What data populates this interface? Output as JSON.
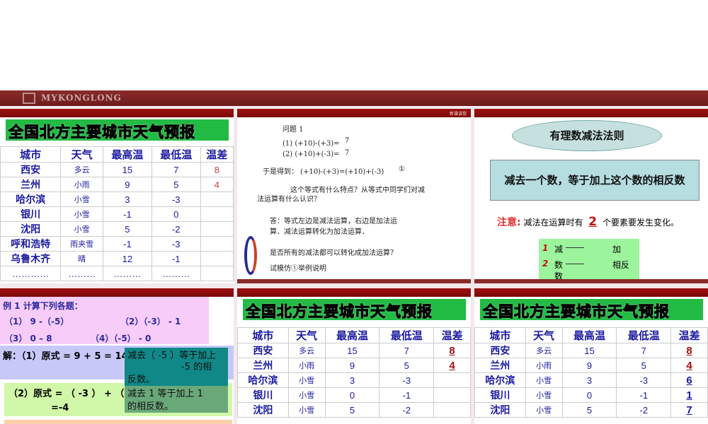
{
  "header": {
    "logo_text": "MYKONGLONG"
  },
  "weather": {
    "title": "全国北方主要城市天气预报",
    "columns": [
      "城市",
      "天气",
      "最高温",
      "最低温",
      "温差"
    ],
    "rows": [
      [
        "西安",
        "多云",
        "15",
        "7",
        "8"
      ],
      [
        "兰州",
        "小雨",
        "9",
        "5",
        "4"
      ],
      [
        "哈尔滨",
        "小雪",
        "3",
        "-3",
        ""
      ],
      [
        "银川",
        "小雪",
        "-1",
        "0",
        ""
      ],
      [
        "沈阳",
        "小雪",
        "5",
        "-2",
        ""
      ],
      [
        "呼和浩特",
        "雨夹雪",
        "-1",
        "-3",
        ""
      ],
      [
        "乌鲁木齐",
        "晴",
        "12",
        "-1",
        ""
      ]
    ],
    "ellipsis": [
      "…………",
      "………",
      "………",
      "………"
    ]
  },
  "weather2": {
    "rows": [
      [
        "西安",
        "多云",
        "15",
        "7",
        "8"
      ],
      [
        "兰州",
        "小雨",
        "9",
        "5",
        "4"
      ],
      [
        "哈尔滨",
        "小雪",
        "3",
        "-3",
        ""
      ],
      [
        "银川",
        "小雪",
        "0",
        "-1",
        ""
      ],
      [
        "沈阳",
        "小雪",
        "5",
        "-2",
        ""
      ]
    ]
  },
  "weather3": {
    "rows": [
      [
        "西安",
        "多云",
        "15",
        "7",
        "8"
      ],
      [
        "兰州",
        "小雨",
        "9",
        "5",
        "4"
      ],
      [
        "哈尔滨",
        "小雪",
        "3",
        "-3",
        "6"
      ],
      [
        "银川",
        "小雪",
        "0",
        "-1",
        "1"
      ],
      [
        "沈阳",
        "小雪",
        "5",
        "-2",
        "7"
      ]
    ]
  },
  "question": {
    "section_label": "新课讲授",
    "title": "问题 1",
    "q1": "(1) (+10)-(+3)=",
    "a1": "7",
    "q2": "(2) (+10)+(-3)=",
    "a2": "7",
    "result": "于是得到： (+10)-(+3)=(+10)+(-3)",
    "marker": "①",
    "prompt1": "这个等式有什么特点？从等式中同学们对减",
    "prompt2": "法运算有什么认识？",
    "answer1": "答：等式左边是减法运算，右边是加法运",
    "answer2": "算．减法运算转化为加法运算．",
    "ask": "是否所有的减法都可以转化成加法运算？",
    "try": "试模仿①举例说明"
  },
  "rule": {
    "title": "有理数减法法则",
    "statement": "减去一个数，等于加上这个数的相反数",
    "note_label": "注意:",
    "note_pre": "减法在运算时有",
    "note_num": "2",
    "note_post": "个要素要发生变化。",
    "items": [
      {
        "n": "1",
        "from": "减",
        "to": "加"
      },
      {
        "n": "2",
        "from": "数",
        "to": "相反",
        "extra": "数"
      }
    ]
  },
  "example": {
    "title": "例 1  计算下列各题：",
    "p1": "（1） 9 -（-5）",
    "p2": "（2）（-3） - 1",
    "p3": "（3） 0 – 8",
    "p4": "（4）（-5）  - 0",
    "sol1": "解：（1）原式 = 9 + 5 = 14",
    "tip1a": "减去（ -5 ）等于加上",
    "tip1b": "-5  的相",
    "tip1c": "反数。",
    "sol2": "（2）原式 = （ -3 ） + （",
    "sol2b": "=-4",
    "tip2a": "减去 1 等于加上     1",
    "tip2b": "的相反数。"
  }
}
